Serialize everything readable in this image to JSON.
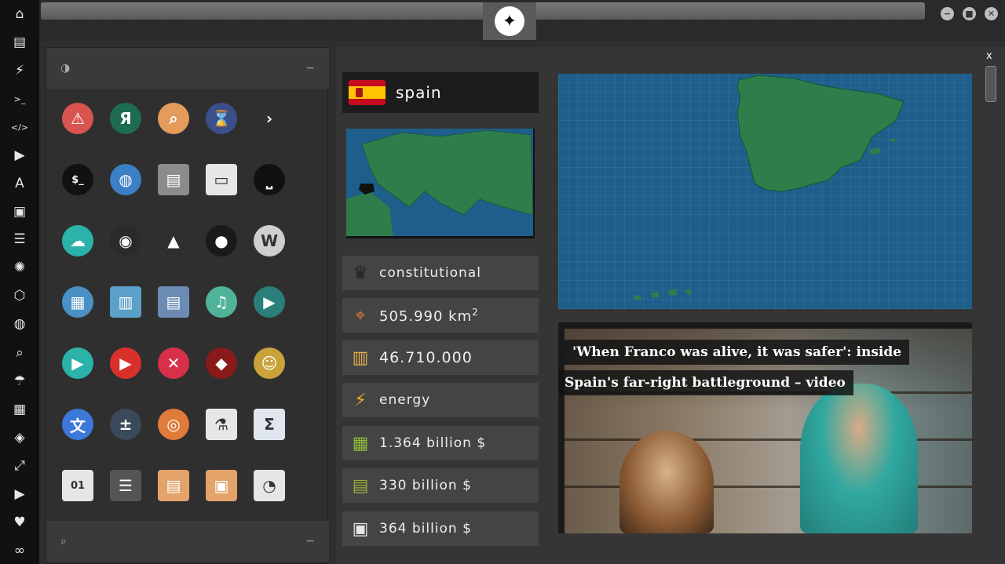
{
  "rail": {
    "items": [
      {
        "name": "home-icon",
        "glyph": "⌂"
      },
      {
        "name": "document-icon",
        "glyph": "▤"
      },
      {
        "name": "lightning-icon",
        "glyph": "⚡"
      },
      {
        "name": "terminal-icon",
        "glyph": ">_"
      },
      {
        "name": "code-icon",
        "glyph": "</>"
      },
      {
        "name": "play-icon",
        "glyph": "▶"
      },
      {
        "name": "translate-icon",
        "glyph": "A"
      },
      {
        "name": "image-icon",
        "glyph": "▣"
      },
      {
        "name": "news-icon",
        "glyph": "☰"
      },
      {
        "name": "empire-icon",
        "glyph": "✺"
      },
      {
        "name": "rebel-icon",
        "glyph": "⬡"
      },
      {
        "name": "globe-icon",
        "glyph": "◍"
      },
      {
        "name": "search-icon",
        "glyph": "⌕"
      },
      {
        "name": "umbrella-icon",
        "glyph": "☂"
      },
      {
        "name": "contact-icon",
        "glyph": "▦"
      },
      {
        "name": "link-icon",
        "glyph": "◈"
      },
      {
        "name": "expand-icon",
        "glyph": "⤢"
      },
      {
        "name": "youtube-icon",
        "glyph": "▶"
      },
      {
        "name": "heart-icon",
        "glyph": "♥"
      },
      {
        "name": "infinity-icon",
        "glyph": "∞"
      }
    ]
  },
  "window": {
    "minimize": "−",
    "maximize": "■",
    "close": "✕",
    "emblem": "✦"
  },
  "app_panel": {
    "top_min": "−",
    "bottom_min": "−",
    "apps": [
      {
        "name": "warning-app-icon",
        "glyph": "⚠",
        "color": "#d9534f"
      },
      {
        "name": "yandex-app-icon",
        "glyph": "Я",
        "color": "#1e6b54"
      },
      {
        "name": "search-app-icon",
        "glyph": "⌕",
        "color": "#e59b5a"
      },
      {
        "name": "hourglass-app-icon",
        "glyph": "⌛",
        "color": "#3b4f8c"
      },
      {
        "name": "arrow-app-icon",
        "glyph": "›",
        "color": "#2f2f2f"
      },
      {
        "name": "terminal-app-icon",
        "glyph": "$_",
        "color": "#111111"
      },
      {
        "name": "globe-app-icon",
        "glyph": "◍",
        "color": "#3b7fc4"
      },
      {
        "name": "scanner-app-icon",
        "glyph": "▤",
        "color": "#8c8c8c"
      },
      {
        "name": "window-app-icon",
        "glyph": "▭",
        "color": "#e6e6e6"
      },
      {
        "name": "keyboard-app-icon",
        "glyph": "⎵",
        "color": "#111111"
      },
      {
        "name": "cloud-lock-app-icon",
        "glyph": "☁",
        "color": "#2bb3a9"
      },
      {
        "name": "github-app-icon",
        "glyph": "◉",
        "color": "#2a2a2a"
      },
      {
        "name": "starfleet-app-icon",
        "glyph": "▲",
        "color": "#2f2f2f"
      },
      {
        "name": "death-star-app-icon",
        "glyph": "●",
        "color": "#1a1a1a"
      },
      {
        "name": "wikipedia-app-icon",
        "glyph": "W",
        "color": "#cfcfcf"
      },
      {
        "name": "map-app-icon",
        "glyph": "▦",
        "color": "#4a90c4"
      },
      {
        "name": "books-app-icon",
        "glyph": "▥",
        "color": "#5aa0c8"
      },
      {
        "name": "notes-app-icon",
        "glyph": "▤",
        "color": "#6b8bb5"
      },
      {
        "name": "music-app-icon",
        "glyph": "♫",
        "color": "#4fb39a"
      },
      {
        "name": "video-app-icon",
        "glyph": "▶",
        "color": "#2a7f7a"
      },
      {
        "name": "player-app-icon",
        "glyph": "▶",
        "color": "#2bb3a9"
      },
      {
        "name": "youtube-app-icon",
        "glyph": "▶",
        "color": "#d9302c"
      },
      {
        "name": "close-app-icon",
        "glyph": "✕",
        "color": "#d9304a"
      },
      {
        "name": "ironman-app-icon",
        "glyph": "◆",
        "color": "#8a1a1a"
      },
      {
        "name": "c3po-app-icon",
        "glyph": "☺",
        "color": "#c9a23a"
      },
      {
        "name": "translate-app-icon",
        "glyph": "文",
        "color": "#3b78d8"
      },
      {
        "name": "calculator-app-icon",
        "glyph": "±",
        "color": "#3a4a5a"
      },
      {
        "name": "photo-app-icon",
        "glyph": "◎",
        "color": "#e07b3a"
      },
      {
        "name": "lab-app-icon",
        "glyph": "⚗",
        "color": "#e6e6e6"
      },
      {
        "name": "formula-app-icon",
        "glyph": "Σ",
        "color": "#dfe6ee"
      },
      {
        "name": "binary-app-icon",
        "glyph": "01",
        "color": "#e6e6e6"
      },
      {
        "name": "text-app-icon",
        "glyph": "☰",
        "color": "#555555"
      },
      {
        "name": "file-app-icon",
        "glyph": "▤",
        "color": "#e3a36a"
      },
      {
        "name": "image-app-icon",
        "glyph": "▣",
        "color": "#e3a36a"
      },
      {
        "name": "presentation-app-icon",
        "glyph": "◔",
        "color": "#e6e6e6"
      }
    ]
  },
  "country": {
    "name": "spain",
    "government": "constitutional",
    "area": "505.990 km",
    "area_sup": "2",
    "population": "46.710.000",
    "resource": "energy",
    "gdp": "1.364 billion $",
    "exports": "330 billion $",
    "imports": "364 billion $"
  },
  "news": {
    "line1": "'When Franco was alive, it was safer': inside",
    "line2": "Spain's far-right battleground – video"
  },
  "close_label": "x",
  "colors": {
    "sea": "#1d5f8a",
    "land": "#2e7d4a",
    "rail": "#111111"
  }
}
